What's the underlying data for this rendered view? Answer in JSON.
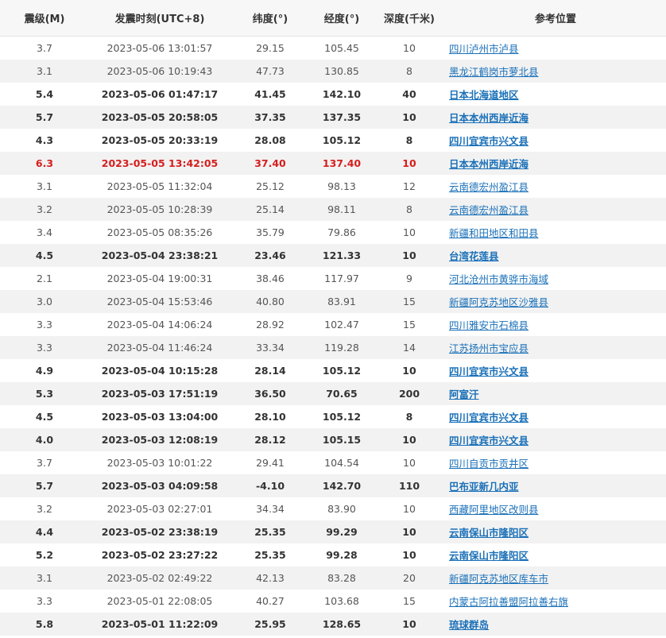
{
  "table": {
    "headers": {
      "magnitude": "震级(M)",
      "time": "发震时刻(UTC+8)",
      "latitude": "纬度(°)",
      "longitude": "经度(°)",
      "depth": "深度(千米)",
      "location": "参考位置"
    },
    "rows": [
      {
        "magnitude": "3.7",
        "time": "2023-05-06 13:01:57",
        "latitude": "29.15",
        "longitude": "105.45",
        "depth": "10",
        "location": "四川泸州市泸县"
      },
      {
        "magnitude": "3.1",
        "time": "2023-05-06 10:19:43",
        "latitude": "47.73",
        "longitude": "130.85",
        "depth": "8",
        "location": "黑龙江鹤岗市萝北县"
      },
      {
        "magnitude": "5.4",
        "time": "2023-05-06 01:47:17",
        "latitude": "41.45",
        "longitude": "142.10",
        "depth": "40",
        "location": "日本北海道地区"
      },
      {
        "magnitude": "5.7",
        "time": "2023-05-05 20:58:05",
        "latitude": "37.35",
        "longitude": "137.35",
        "depth": "10",
        "location": "日本本州西岸近海"
      },
      {
        "magnitude": "4.3",
        "time": "2023-05-05 20:33:19",
        "latitude": "28.08",
        "longitude": "105.12",
        "depth": "8",
        "location": "四川宜宾市兴文县"
      },
      {
        "magnitude": "6.3",
        "time": "2023-05-05 13:42:05",
        "latitude": "37.40",
        "longitude": "137.40",
        "depth": "10",
        "location": "日本本州西岸近海"
      },
      {
        "magnitude": "3.1",
        "time": "2023-05-05 11:32:04",
        "latitude": "25.12",
        "longitude": "98.13",
        "depth": "12",
        "location": "云南德宏州盈江县"
      },
      {
        "magnitude": "3.2",
        "time": "2023-05-05 10:28:39",
        "latitude": "25.14",
        "longitude": "98.11",
        "depth": "8",
        "location": "云南德宏州盈江县"
      },
      {
        "magnitude": "3.4",
        "time": "2023-05-05 08:35:26",
        "latitude": "35.79",
        "longitude": "79.86",
        "depth": "10",
        "location": "新疆和田地区和田县"
      },
      {
        "magnitude": "4.5",
        "time": "2023-05-04 23:38:21",
        "latitude": "23.46",
        "longitude": "121.33",
        "depth": "10",
        "location": "台湾花莲县"
      },
      {
        "magnitude": "2.1",
        "time": "2023-05-04 19:00:31",
        "latitude": "38.46",
        "longitude": "117.97",
        "depth": "9",
        "location": "河北沧州市黄骅市海域"
      },
      {
        "magnitude": "3.0",
        "time": "2023-05-04 15:53:46",
        "latitude": "40.80",
        "longitude": "83.91",
        "depth": "15",
        "location": "新疆阿克苏地区沙雅县"
      },
      {
        "magnitude": "3.3",
        "time": "2023-05-04 14:06:24",
        "latitude": "28.92",
        "longitude": "102.47",
        "depth": "15",
        "location": "四川雅安市石棉县"
      },
      {
        "magnitude": "3.3",
        "time": "2023-05-04 11:46:24",
        "latitude": "33.34",
        "longitude": "119.28",
        "depth": "14",
        "location": "江苏扬州市宝应县"
      },
      {
        "magnitude": "4.9",
        "time": "2023-05-04 10:15:28",
        "latitude": "28.14",
        "longitude": "105.12",
        "depth": "10",
        "location": "四川宜宾市兴文县"
      },
      {
        "magnitude": "5.3",
        "time": "2023-05-03 17:51:19",
        "latitude": "36.50",
        "longitude": "70.65",
        "depth": "200",
        "location": "阿富汗"
      },
      {
        "magnitude": "4.5",
        "time": "2023-05-03 13:04:00",
        "latitude": "28.10",
        "longitude": "105.12",
        "depth": "8",
        "location": "四川宜宾市兴文县"
      },
      {
        "magnitude": "4.0",
        "time": "2023-05-03 12:08:19",
        "latitude": "28.12",
        "longitude": "105.15",
        "depth": "10",
        "location": "四川宜宾市兴文县"
      },
      {
        "magnitude": "3.7",
        "time": "2023-05-03 10:01:22",
        "latitude": "29.41",
        "longitude": "104.54",
        "depth": "10",
        "location": "四川自贡市贡井区"
      },
      {
        "magnitude": "5.7",
        "time": "2023-05-03 04:09:58",
        "latitude": "-4.10",
        "longitude": "142.70",
        "depth": "110",
        "location": "巴布亚新几内亚"
      },
      {
        "magnitude": "3.2",
        "time": "2023-05-03 02:27:01",
        "latitude": "34.34",
        "longitude": "83.90",
        "depth": "10",
        "location": "西藏阿里地区改则县"
      },
      {
        "magnitude": "4.4",
        "time": "2023-05-02 23:38:19",
        "latitude": "25.35",
        "longitude": "99.29",
        "depth": "10",
        "location": "云南保山市隆阳区"
      },
      {
        "magnitude": "5.2",
        "time": "2023-05-02 23:27:22",
        "latitude": "25.35",
        "longitude": "99.28",
        "depth": "10",
        "location": "云南保山市隆阳区"
      },
      {
        "magnitude": "3.1",
        "time": "2023-05-02 02:49:22",
        "latitude": "42.13",
        "longitude": "83.28",
        "depth": "20",
        "location": "新疆阿克苏地区库车市"
      },
      {
        "magnitude": "3.3",
        "time": "2023-05-01 22:08:05",
        "latitude": "40.27",
        "longitude": "103.68",
        "depth": "15",
        "location": "内蒙古阿拉善盟阿拉善右旗"
      },
      {
        "magnitude": "5.8",
        "time": "2023-05-01 11:22:09",
        "latitude": "25.95",
        "longitude": "128.65",
        "depth": "10",
        "location": "琉球群岛"
      }
    ]
  },
  "colors": {
    "link": "#1a70b8",
    "alert": "#d61e1e",
    "row_stripe": "#f2f2f2",
    "header_bg": "#f7f7f7"
  }
}
